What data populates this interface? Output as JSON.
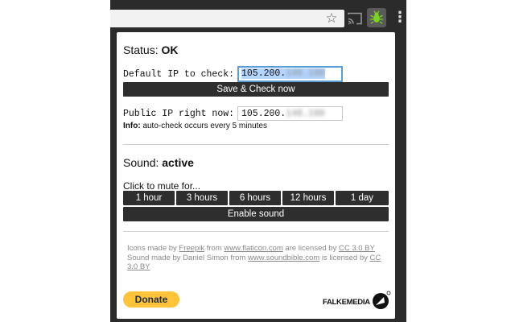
{
  "browser": {
    "star_glyph": "☆",
    "menu_glyph": "⋮",
    "extension_icon": "green-bug-icon",
    "extension_color": "#7bd321"
  },
  "popup": {
    "status": {
      "label": "Status:",
      "value": "OK"
    },
    "default_ip": {
      "label": "Default IP to check:",
      "value_prefix": "105.200.",
      "value_blurred": "148.190"
    },
    "save_button": "Save & Check now",
    "public_ip": {
      "label": "Public IP right now:",
      "value_prefix": "105.200.",
      "value_blurred": "148.190"
    },
    "info": {
      "label": "Info:",
      "text": "auto-check occurs every 5 minutes"
    },
    "sound": {
      "label": "Sound:",
      "value": "active"
    },
    "mute": {
      "label": "Click to mute for...",
      "options": [
        "1 hour",
        "3 hours",
        "6 hours",
        "12 hours",
        "1 day"
      ],
      "enable_button": "Enable sound"
    },
    "credits": {
      "line1_pre": "Icons made by ",
      "line1_author": "Freepik",
      "line1_from": " from ",
      "line1_site": "www.flaticon.com",
      "line1_licensed": " are licensed by ",
      "line1_license": "CC 3.0 BY",
      "line2_pre": "Sound made by Daniel Simon from ",
      "line2_site": "www.soundbible.com",
      "line2_licensed": " is licensed by ",
      "line2_license": "CC 3.0 BY"
    },
    "donate_button": "Donate",
    "brand": "FALKEMEDIA",
    "colors": {
      "button_bg": "#2e2e2e",
      "donate_bg": "#ffc439",
      "focus_border": "#5b9dd9",
      "selection": "#b4d5fe"
    }
  }
}
